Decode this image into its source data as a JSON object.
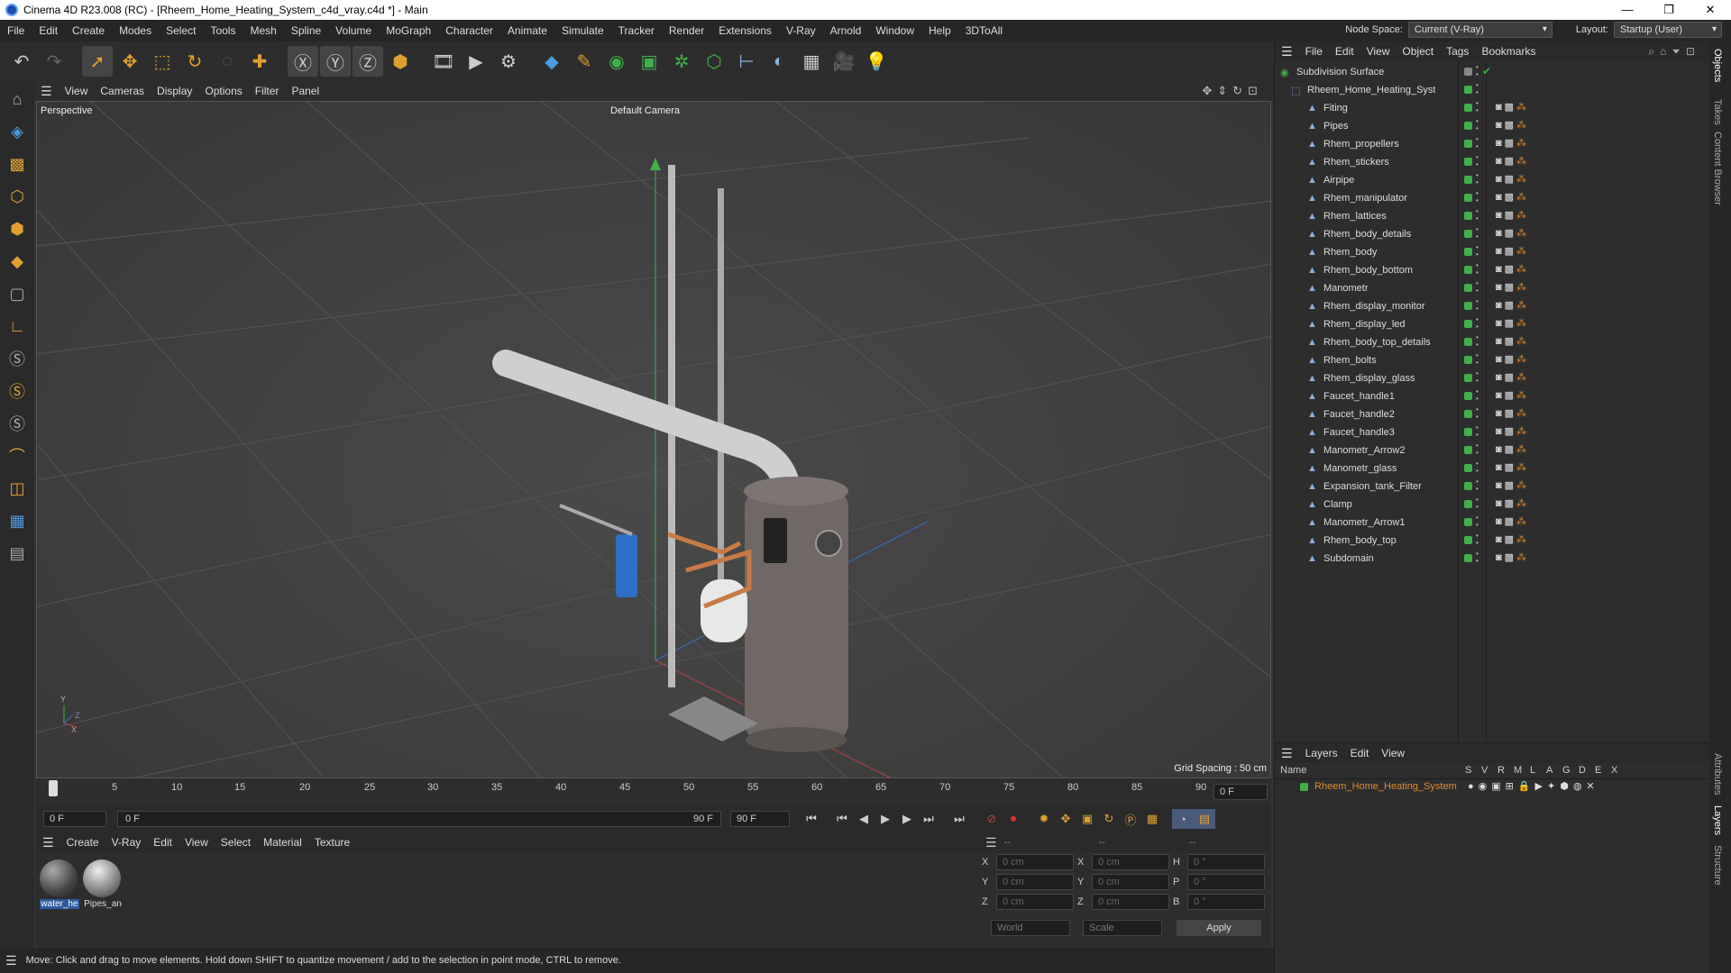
{
  "window": {
    "title": "Cinema 4D R23.008 (RC) - [Rheem_Home_Heating_System_c4d_vray.c4d *] - Main"
  },
  "menubar": {
    "items": [
      "File",
      "Edit",
      "Create",
      "Modes",
      "Select",
      "Tools",
      "Mesh",
      "Spline",
      "Volume",
      "MoGraph",
      "Character",
      "Animate",
      "Simulate",
      "Tracker",
      "Render",
      "Extensions",
      "V-Ray",
      "Arnold",
      "Window",
      "Help",
      "3DToAll"
    ],
    "node_space_label": "Node Space:",
    "node_space_value": "Current (V-Ray)",
    "layout_label": "Layout:",
    "layout_value": "Startup (User)"
  },
  "viewport_menu": {
    "items": [
      "View",
      "Cameras",
      "Display",
      "Options",
      "Filter",
      "Panel"
    ]
  },
  "viewport": {
    "name": "Perspective",
    "camera": "Default Camera",
    "grid_spacing": "Grid Spacing : 50 cm"
  },
  "timeline": {
    "ticks": [
      "0",
      "5",
      "10",
      "15",
      "20",
      "25",
      "30",
      "35",
      "40",
      "45",
      "50",
      "55",
      "60",
      "65",
      "70",
      "75",
      "80",
      "85",
      "90"
    ],
    "current_frame": "0 F"
  },
  "transport": {
    "start": "0 F",
    "range_start": "0 F",
    "range_end": "90 F",
    "end": "90 F"
  },
  "material_menu": {
    "items": [
      "Create",
      "V-Ray",
      "Edit",
      "View",
      "Select",
      "Material",
      "Texture"
    ]
  },
  "materials": [
    {
      "name": "water_he"
    },
    {
      "name": "Pipes_an"
    }
  ],
  "coords": {
    "header": [
      "--",
      "--",
      "--"
    ],
    "rows": [
      {
        "a": "X",
        "av": "0 cm",
        "b": "X",
        "bv": "0 cm",
        "c": "H",
        "cv": "0 °"
      },
      {
        "a": "Y",
        "av": "0 cm",
        "b": "Y",
        "bv": "0 cm",
        "c": "P",
        "cv": "0 °"
      },
      {
        "a": "Z",
        "av": "0 cm",
        "b": "Z",
        "bv": "0 cm",
        "c": "B",
        "cv": "0 °"
      }
    ],
    "world": "World",
    "scale": "Scale",
    "apply": "Apply"
  },
  "status": "Move: Click and drag to move elements. Hold down SHIFT to quantize movement / add to the selection in point mode, CTRL to remove.",
  "objects_menu": {
    "items": [
      "File",
      "Edit",
      "View",
      "Object",
      "Tags",
      "Bookmarks"
    ]
  },
  "objects": {
    "root": "Subdivision Surface",
    "group": "Rheem_Home_Heating_System",
    "children": [
      "Fiting",
      "Pipes",
      "Rhem_propellers",
      "Rhem_stickers",
      "Airpipe",
      "Rhem_manipulator",
      "Rhem_lattices",
      "Rhem_body_details",
      "Rhem_body",
      "Rhem_body_bottom",
      "Manometr",
      "Rhem_display_monitor",
      "Rhem_display_led",
      "Rhem_body_top_details",
      "Rhem_bolts",
      "Rhem_display_glass",
      "Faucet_handle1",
      "Faucet_handle2",
      "Faucet_handle3",
      "Manometr_Arrow2",
      "Manometr_glass",
      "Expansion_tank_Filter",
      "Clamp",
      "Manometr_Arrow1",
      "Rhem_body_top",
      "Subdomain"
    ]
  },
  "layers_menu": {
    "items": [
      "Layers",
      "Edit",
      "View"
    ]
  },
  "layers": {
    "columns": [
      "Name",
      "S",
      "V",
      "R",
      "M",
      "L",
      "A",
      "G",
      "D",
      "E",
      "X"
    ],
    "row": "Rheem_Home_Heating_System"
  },
  "side_tabs": [
    "Objects",
    "Takes",
    "Content Browser",
    "Attributes",
    "Layers",
    "Structure"
  ],
  "colors": {
    "accent": "#e08a2c",
    "selected_layer": "#e08a2c",
    "green": "#3fb04a"
  }
}
